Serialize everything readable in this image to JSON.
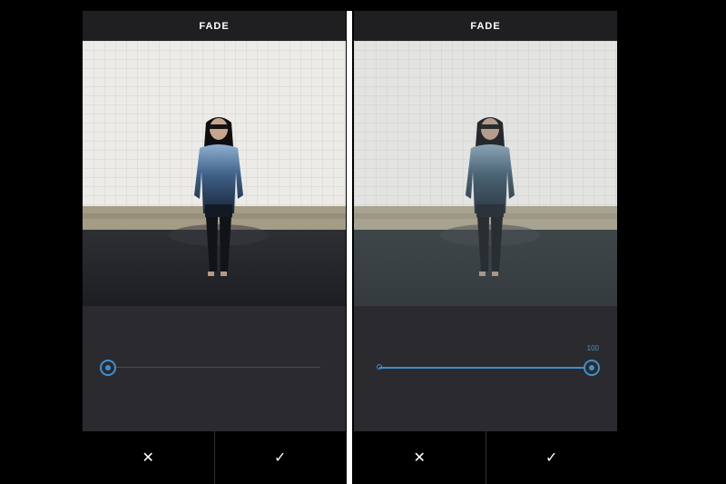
{
  "panels": [
    {
      "title": "FADE",
      "fade_value": 0,
      "value_label": "",
      "cancel_icon": "✕",
      "confirm_icon": "✓"
    },
    {
      "title": "FADE",
      "fade_value": 100,
      "value_label": "100",
      "cancel_icon": "✕",
      "confirm_icon": "✓"
    }
  ],
  "colors": {
    "accent": "#3f8fcf",
    "panel_bg": "#2b2b2f",
    "header_bg": "#1f1f22"
  },
  "icons": {
    "cancel": "close-icon",
    "confirm": "checkmark-icon",
    "slider_knob": "slider-knob-icon"
  }
}
